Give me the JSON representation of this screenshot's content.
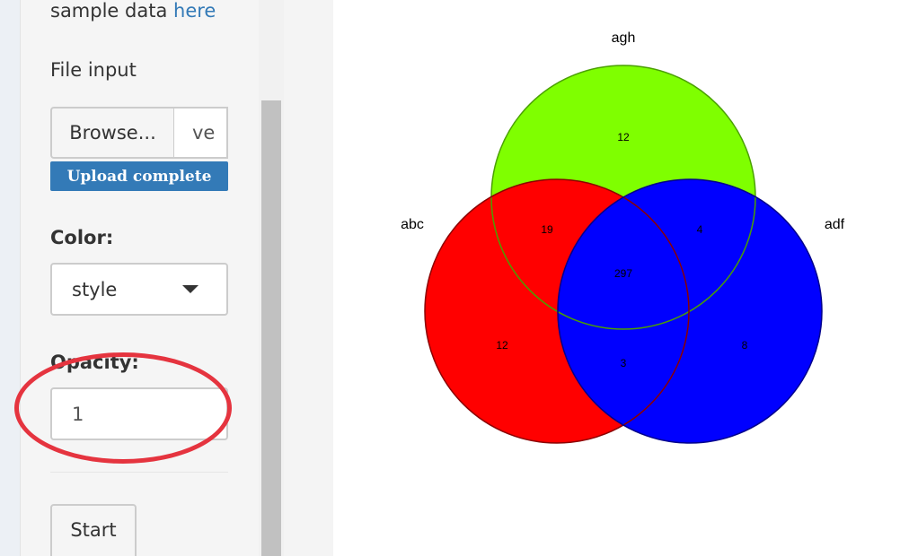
{
  "sidebar": {
    "sample_prefix": "sample data ",
    "sample_link": "here",
    "file_input_label": "File input",
    "browse_label": "Browse...",
    "file_name_value": "ve",
    "upload_status": "Upload complete",
    "color_label": "Color:",
    "color_selected": "style",
    "opacity_label": "Opacity:",
    "opacity_value": "1",
    "start_label": "Start"
  },
  "colors": {
    "accent": "#337ab7",
    "highlight_ring": "#e5343f",
    "venn_agh": "#7fff00",
    "venn_abc": "#ff0000",
    "venn_adf": "#0000ff"
  },
  "chart_data": {
    "type": "venn",
    "sets": [
      "agh",
      "abc",
      "adf"
    ],
    "regions": [
      {
        "sets": [
          "agh"
        ],
        "value": 12
      },
      {
        "sets": [
          "abc",
          "agh"
        ],
        "value": 19
      },
      {
        "sets": [
          "agh",
          "adf"
        ],
        "value": 4
      },
      {
        "sets": [
          "abc",
          "agh",
          "adf"
        ],
        "value": 297
      },
      {
        "sets": [
          "abc"
        ],
        "value": 12
      },
      {
        "sets": [
          "abc",
          "adf"
        ],
        "value": 3
      },
      {
        "sets": [
          "adf"
        ],
        "value": 8
      }
    ]
  }
}
